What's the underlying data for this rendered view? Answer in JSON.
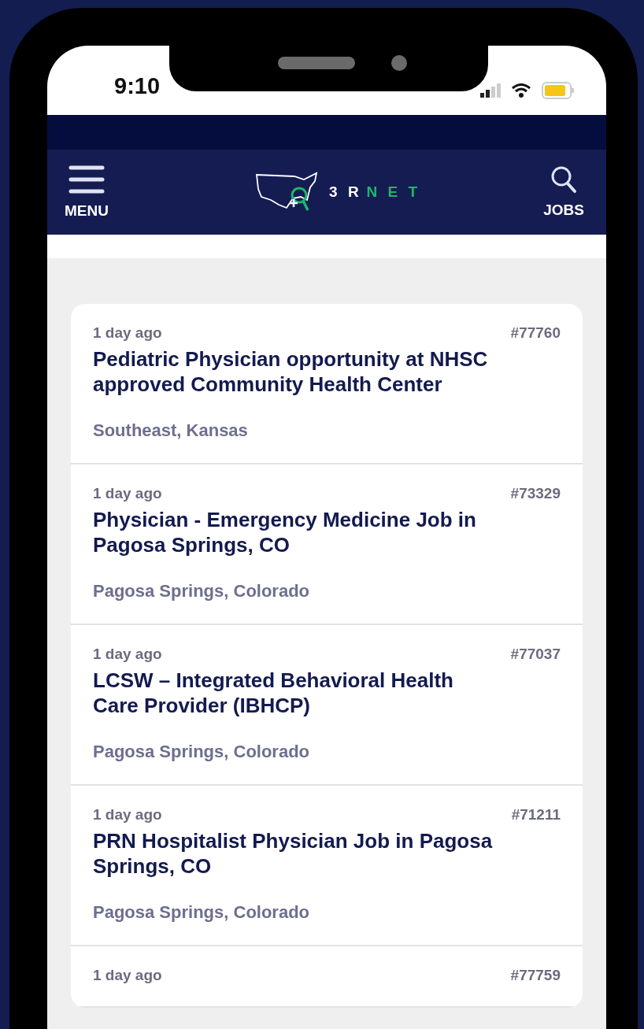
{
  "status_bar": {
    "time": "9:10"
  },
  "nav": {
    "menu_label": "MENU",
    "logo_text": "3 R",
    "logo_accent": "N E T",
    "jobs_label": "JOBS"
  },
  "jobs": [
    {
      "posted": "1 day ago",
      "id": "#77760",
      "title": "Pediatric Physician opportunity at NHSC approved Community Health Center",
      "location": "Southeast, Kansas"
    },
    {
      "posted": "1 day ago",
      "id": "#73329",
      "title": "Physician - Emergency Medicine Job in Pagosa Springs, CO",
      "location": "Pagosa Springs, Colorado"
    },
    {
      "posted": "1 day ago",
      "id": "#77037",
      "title": "LCSW – Integrated Behavioral Health Care Provider (IBHCP)",
      "location": "Pagosa Springs, Colorado"
    },
    {
      "posted": "1 day ago",
      "id": "#71211",
      "title": "PRN Hospitalist Physician Job in Pagosa Springs, CO",
      "location": "Pagosa Springs, Colorado"
    },
    {
      "posted": "1 day ago",
      "id": "#77759"
    }
  ]
}
